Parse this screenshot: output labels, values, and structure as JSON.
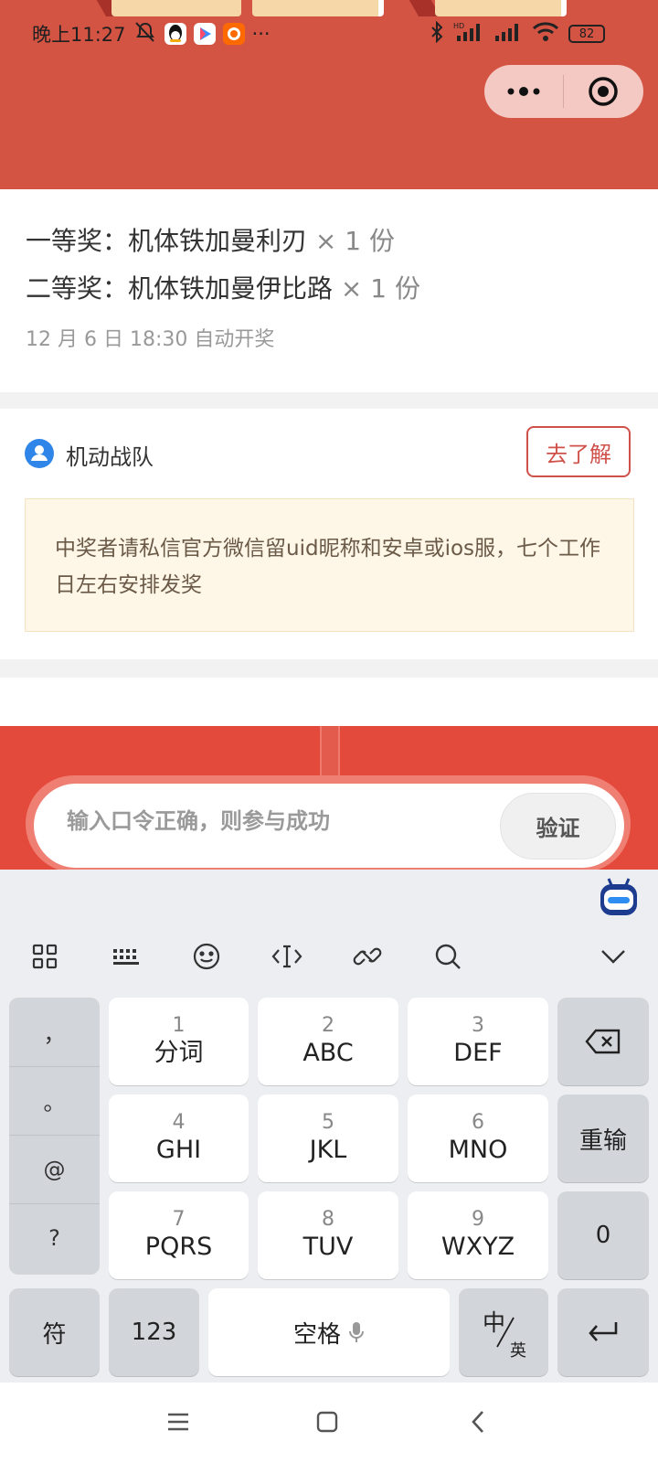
{
  "status_bar": {
    "time": "晚上11:27",
    "more": "···",
    "battery": "82"
  },
  "prizes": {
    "first": {
      "label": "一等奖：机体铁加曼利刃",
      "count": " × 1 份"
    },
    "second": {
      "label": "二等奖：机体铁加曼伊比路",
      "count": " × 1 份"
    },
    "draw_time": "12 月 6 日 18:30 自动开奖"
  },
  "organizer": {
    "name": "机动战队",
    "learn_button": "去了解",
    "notice": "中奖者请私信官方微信留uid昵称和安卓或ios服，七个工作日左右安排发奖"
  },
  "password": {
    "placeholder": "输入口令正确，则参与成功",
    "verify_button": "验证"
  },
  "keyboard": {
    "toolbar_icons": [
      "apps-grid-icon",
      "keyboard-icon",
      "emoji-icon",
      "cursor-icon",
      "link-icon",
      "search-icon",
      "collapse-icon"
    ],
    "punctuation": [
      "，",
      "。",
      "@",
      "?"
    ],
    "rows": [
      [
        {
          "num": "1",
          "label": "分词"
        },
        {
          "num": "2",
          "label": "ABC"
        },
        {
          "num": "3",
          "label": "DEF"
        }
      ],
      [
        {
          "num": "4",
          "label": "GHI"
        },
        {
          "num": "5",
          "label": "JKL"
        },
        {
          "num": "6",
          "label": "MNO"
        }
      ],
      [
        {
          "num": "7",
          "label": "PQRS"
        },
        {
          "num": "8",
          "label": "TUV"
        },
        {
          "num": "9",
          "label": "WXYZ"
        }
      ]
    ],
    "side": {
      "reinput": "重输",
      "zero": "0"
    },
    "bottom": {
      "symbols": "符",
      "numbers": "123",
      "space": "空格",
      "lang_zh": "中",
      "lang_en": "英"
    }
  },
  "colors": {
    "header_red": "#d45444",
    "accent_red": "#d0504a",
    "notice_bg": "#fef6e6"
  }
}
